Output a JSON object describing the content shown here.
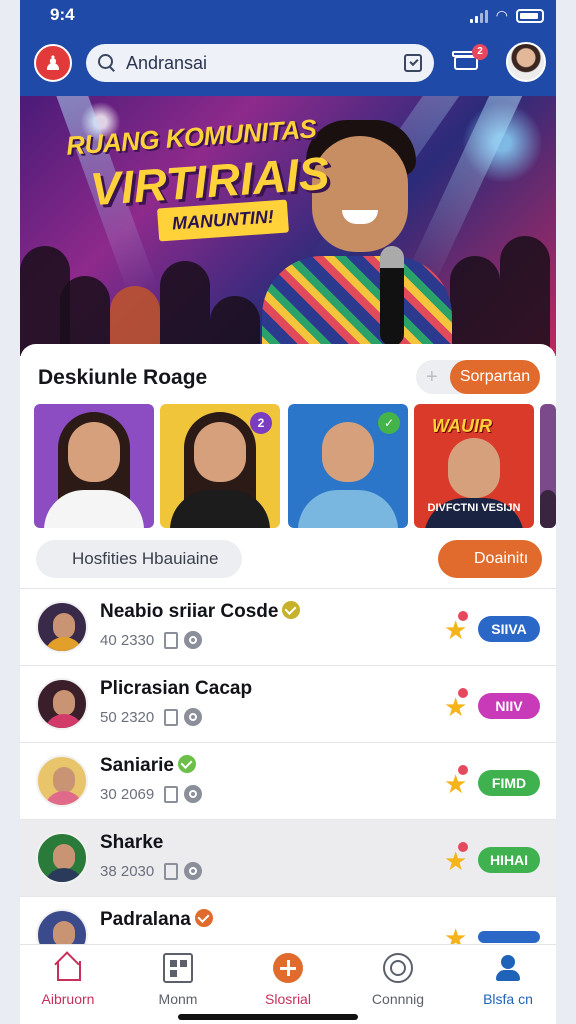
{
  "status_bar": {
    "time": "9:4"
  },
  "header": {
    "search_text": "Andransai",
    "notification_count": "2"
  },
  "hero": {
    "title_line1": "RUANG KOMUNITAS",
    "title_line2": "VIRTIRIAIS",
    "chip": "MANUNTIN!"
  },
  "section": {
    "title": "Deskiunle Roage",
    "toggle_label": "Sorpartan"
  },
  "thumbnails": [
    {
      "bg": "#8c4cc2",
      "body": "#f5f5f5",
      "tag": ""
    },
    {
      "bg": "#f0c53a",
      "body": "#1c1c1c",
      "tag": "2",
      "tag_color": "#7a3cc0"
    },
    {
      "bg": "#2b76c9",
      "body": "#7ab7e0",
      "tag": "",
      "tag_color": "#44b34a"
    },
    {
      "bg": "#d93a2a",
      "body": "#1b2342",
      "tag": "",
      "poster": "WAUIR",
      "caption": "DIVFCTNI VESIJN"
    },
    {
      "bg": "#7b4a8a",
      "body": "#3a2540",
      "tag": ""
    }
  ],
  "filters": {
    "search_text": "Hosfities Hbauiaine",
    "button_label": "Doainitı"
  },
  "rows": [
    {
      "name": "Neabio sriiar Cosde",
      "meta": "40 2330",
      "verify_color": "#c7b12a",
      "pill": "SIIVA",
      "pill_color": "#2a67c7",
      "heart_color": "#e8485e",
      "avatar_bg": "#3a2a4a",
      "avatar_body": "#e2a02a"
    },
    {
      "name": "Plicrasian Cacap",
      "meta": "50 2320",
      "verify_color": "",
      "pill": "NIIV",
      "pill_color": "#c93ab8",
      "heart_color": "#e8485e",
      "avatar_bg": "#3a1f2a",
      "avatar_body": "#d23a6a"
    },
    {
      "name": "Saniarie",
      "meta": "30 2069",
      "verify_color": "#6cc04a",
      "pill": "FIMD",
      "pill_color": "#3fb24f",
      "heart_color": "#e8485e",
      "avatar_bg": "#e8c56a",
      "avatar_body": "#e06a8a"
    },
    {
      "name": "Sharke",
      "meta": "38 2030",
      "verify_color": "",
      "pill": "HIHAI",
      "pill_color": "#3fb24f",
      "heart_color": "#e8485e",
      "avatar_bg": "#2a7a3a",
      "avatar_body": "#2a3a5a"
    },
    {
      "name": "Padralana",
      "meta": "",
      "verify_color": "#e06b2c",
      "pill": "",
      "pill_color": "#2a67c7",
      "heart_color": "#e8485e",
      "avatar_bg": "#3a4a8a",
      "avatar_body": "#d23a4a"
    }
  ],
  "bottom_nav": [
    {
      "label": "Aibruorn",
      "icon": "home-icon",
      "color": "#c7305a"
    },
    {
      "label": "Monm",
      "icon": "grid-icon",
      "color": "#5b606b"
    },
    {
      "label": "Slosrial",
      "icon": "plus-icon",
      "color": "#c7305a"
    },
    {
      "label": "Connnig",
      "icon": "connect-icon",
      "color": "#5b606b"
    },
    {
      "label": "Blsfa cn",
      "icon": "user-icon",
      "color": "#1f63b8"
    }
  ]
}
